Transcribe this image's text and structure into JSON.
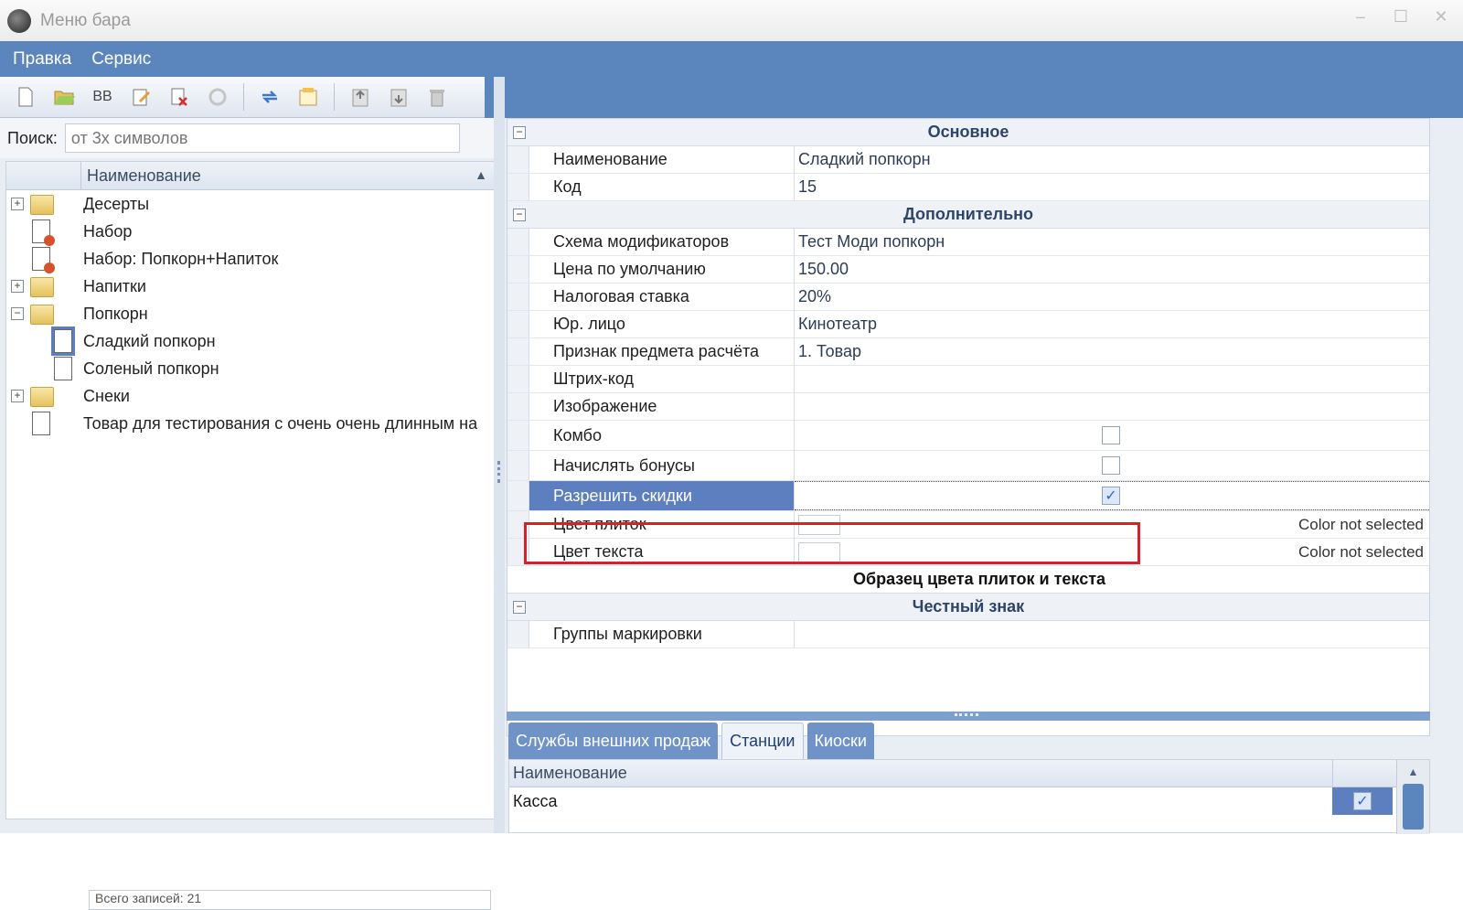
{
  "window": {
    "title": "Меню бара"
  },
  "menu": [
    "Правка",
    "Сервис"
  ],
  "toolbar": {
    "icons": [
      "new-document-icon",
      "open-folder-icon",
      "bb-icon",
      "edit-icon",
      "delete-red-icon",
      "refresh-disabled-icon",
      "sync-icon",
      "properties-icon",
      "move-up-icon",
      "move-down-icon",
      "trash-icon"
    ],
    "bb_label": "BB"
  },
  "search": {
    "label": "Поиск:",
    "placeholder": "от 3х символов"
  },
  "tree": {
    "column": "Наименование",
    "items": [
      {
        "label": "Десерты",
        "type": "folder",
        "expander": "+"
      },
      {
        "label": "Набор",
        "type": "combo"
      },
      {
        "label": "Набор: Попкорн+Напиток",
        "type": "combo"
      },
      {
        "label": "Напитки",
        "type": "folder",
        "expander": "+"
      },
      {
        "label": "Попкорн",
        "type": "folder",
        "expander": "−"
      },
      {
        "label": "Сладкий попкорн",
        "type": "doc",
        "selected": true
      },
      {
        "label": "Соленый попкорн",
        "type": "doc"
      },
      {
        "label": "Снеки",
        "type": "folder",
        "expander": "+"
      },
      {
        "label": "Товар для тестирования с очень очень длинным на",
        "type": "doc"
      }
    ],
    "footer": "Всего записей: 21"
  },
  "props": {
    "cat_main": "Основное",
    "name_label": "Наименование",
    "name_value": "Сладкий попкорн",
    "code_label": "Код",
    "code_value": "15",
    "cat_extra": "Дополнительно",
    "modscheme_label": "Схема модификаторов",
    "modscheme_value": "Тест Моди попкорн",
    "price_label": "Цена по умолчанию",
    "price_value": "150.00",
    "tax_label": "Налоговая ставка",
    "tax_value": "20%",
    "entity_label": "Юр. лицо",
    "entity_value": "Кинотеатр",
    "calc_label": "Признак предмета расчёта",
    "calc_value": "1. Товар",
    "barcode_label": "Штрих-код",
    "image_label": "Изображение",
    "combo_label": "Комбо",
    "combo_checked": false,
    "bonus_label": "Начислять бонусы",
    "bonus_checked": false,
    "discount_label": "Разрешить скидки",
    "discount_checked": true,
    "tile_color_label": "Цвет плиток",
    "tile_color_note": "Color not selected",
    "text_color_label": "Цвет текста",
    "text_color_note": "Color not selected",
    "sample_label": "Образец цвета плиток и текста",
    "cat_honest": "Честный знак",
    "marking_label": "Группы маркировки"
  },
  "tabs": [
    {
      "label": "Службы внешних продаж",
      "active": false
    },
    {
      "label": "Станции",
      "active": true
    },
    {
      "label": "Киоски",
      "active": false
    }
  ],
  "bottom_grid": {
    "column": "Наименование",
    "rows": [
      {
        "name": "Касса",
        "checked": true
      }
    ]
  },
  "colors": {
    "accent": "#5b85bd",
    "selection": "#5d7fbf",
    "highlight_border": "#d0232a"
  }
}
